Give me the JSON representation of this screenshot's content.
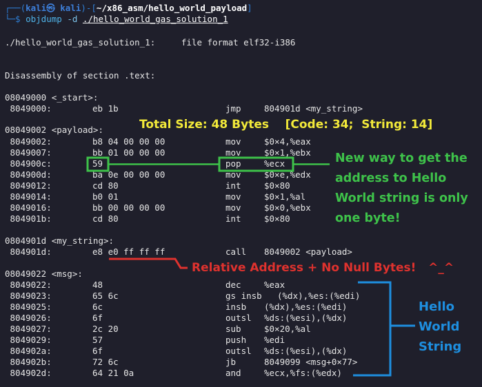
{
  "prompt": {
    "line1_open": "┌──(",
    "user": "kali㉿ kali",
    "line1_mid": ")-[",
    "path": "~/x86_asm/hello_world_payload",
    "line1_close": "]",
    "line2_prefix": "└─$ ",
    "command": "objdump",
    "flag": "-d",
    "argument": "./hello_world_gas_solution_1"
  },
  "output": {
    "file_line": "./hello_world_gas_solution_1:     file format elf32-i386",
    "section_line": "Disassembly of section .text:",
    "sections": [
      {
        "header": "08049000 <_start>:",
        "rows": [
          {
            "addr": " 8049000:",
            "bytes": "eb 1b",
            "mnem": "jmp",
            "ops": "804901d <my_string>"
          }
        ]
      },
      {
        "header": "08049002 <payload>:",
        "rows": [
          {
            "addr": " 8049002:",
            "bytes": "b8 04 00 00 00",
            "mnem": "mov",
            "ops": "$0×4,%eax"
          },
          {
            "addr": " 8049007:",
            "bytes": "bb 01 00 00 00",
            "mnem": "mov",
            "ops": "$0×1,%ebx"
          },
          {
            "addr": " 804900c:",
            "bytes": "59",
            "mnem": "pop",
            "ops": "%ecx"
          },
          {
            "addr": " 804900d:",
            "bytes": "ba 0e 00 00 00",
            "mnem": "mov",
            "ops": "$0×e,%edx"
          },
          {
            "addr": " 8049012:",
            "bytes": "cd 80",
            "mnem": "int",
            "ops": "$0×80"
          },
          {
            "addr": " 8049014:",
            "bytes": "b0 01",
            "mnem": "mov",
            "ops": "$0×1,%al"
          },
          {
            "addr": " 8049016:",
            "bytes": "bb 00 00 00 00",
            "mnem": "mov",
            "ops": "$0×0,%ebx"
          },
          {
            "addr": " 804901b:",
            "bytes": "cd 80",
            "mnem": "int",
            "ops": "$0×80"
          }
        ]
      },
      {
        "header": "0804901d <my_string>:",
        "rows": [
          {
            "addr": " 804901d:",
            "bytes": "e8 e0 ff ff ff",
            "mnem": "call",
            "ops": "8049002 <payload>"
          }
        ]
      },
      {
        "header": "08049022 <msg>:",
        "rows": [
          {
            "addr": " 8049022:",
            "bytes": "48",
            "mnem": "dec",
            "ops": "%eax"
          },
          {
            "addr": " 8049023:",
            "bytes": "65 6c",
            "mnem": "gs insb",
            "ops": "(%dx),%es:(%edi)"
          },
          {
            "addr": " 8049025:",
            "bytes": "6c",
            "mnem": "insb",
            "ops": "(%dx),%es:(%edi)"
          },
          {
            "addr": " 8049026:",
            "bytes": "6f",
            "mnem": "outsl",
            "ops": "%ds:(%esi),(%dx)"
          },
          {
            "addr": " 8049027:",
            "bytes": "2c 20",
            "mnem": "sub",
            "ops": "$0×20,%al"
          },
          {
            "addr": " 8049029:",
            "bytes": "57",
            "mnem": "push",
            "ops": "%edi"
          },
          {
            "addr": " 804902a:",
            "bytes": "6f",
            "mnem": "outsl",
            "ops": "%ds:(%esi),(%dx)"
          },
          {
            "addr": " 804902b:",
            "bytes": "72 6c",
            "mnem": "jb",
            "ops": "8049099 <msg+0×77>"
          },
          {
            "addr": " 804902d:",
            "bytes": "64 21 0a",
            "mnem": "and",
            "ops": "%ecx,%fs:(%edx)"
          }
        ]
      }
    ]
  },
  "annotations": {
    "total_size": "Total Size: 48 Bytes    [Code: 34;  String: 14]",
    "new_way": [
      "New way to get the",
      "address to Hello",
      "World string is only",
      "one byte!"
    ],
    "relative": "Relative Address + No Null Bytes!   ^_^",
    "hello_world": [
      "Hello",
      "World",
      "String"
    ]
  },
  "colors": {
    "background": "#1f1f2b",
    "green_annotation": "#3ec24a",
    "red_annotation": "#e0322e",
    "blue_annotation": "#1e8fe0",
    "yellow_annotation": "#f3ea3a"
  }
}
